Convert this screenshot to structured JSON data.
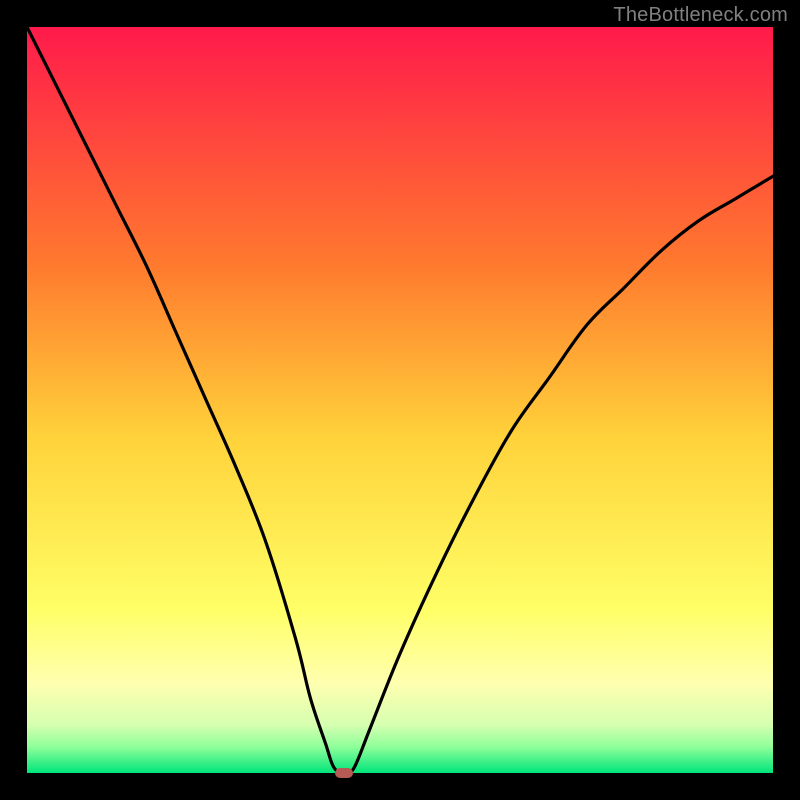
{
  "watermark": "TheBottleneck.com",
  "colors": {
    "top": "#ff1a4b",
    "upper_mid": "#ffa13a",
    "mid": "#ffe23a",
    "lower_mid": "#ffff80",
    "near_bottom": "#c9ff8a",
    "bottom": "#00e57a",
    "curve": "#000000",
    "marker": "#b55a54",
    "frame_bg": "#000000"
  },
  "chart_data": {
    "type": "line",
    "title": "",
    "xlabel": "",
    "ylabel": "",
    "xlim": [
      0,
      100
    ],
    "ylim": [
      0,
      100
    ],
    "series": [
      {
        "name": "bottleneck-curve",
        "x": [
          0,
          4,
          8,
          12,
          16,
          20,
          24,
          28,
          32,
          36,
          38,
          40,
          41,
          42,
          43,
          44,
          46,
          50,
          55,
          60,
          65,
          70,
          75,
          80,
          85,
          90,
          95,
          100
        ],
        "y": [
          100,
          92,
          84,
          76,
          68,
          59,
          50,
          41,
          31,
          18,
          10,
          4,
          1,
          0,
          0,
          1,
          6,
          16,
          27,
          37,
          46,
          53,
          60,
          65,
          70,
          74,
          77,
          80
        ]
      }
    ],
    "marker": {
      "x": 42.5,
      "y": 0
    },
    "gradient_stops": [
      {
        "offset": 0.0,
        "color": "#ff1a4b"
      },
      {
        "offset": 0.32,
        "color": "#ff7a2e"
      },
      {
        "offset": 0.55,
        "color": "#ffd23a"
      },
      {
        "offset": 0.78,
        "color": "#ffff66"
      },
      {
        "offset": 0.88,
        "color": "#ffffb0"
      },
      {
        "offset": 0.935,
        "color": "#d6ffb0"
      },
      {
        "offset": 0.965,
        "color": "#8fff9a"
      },
      {
        "offset": 1.0,
        "color": "#00e57a"
      }
    ]
  }
}
